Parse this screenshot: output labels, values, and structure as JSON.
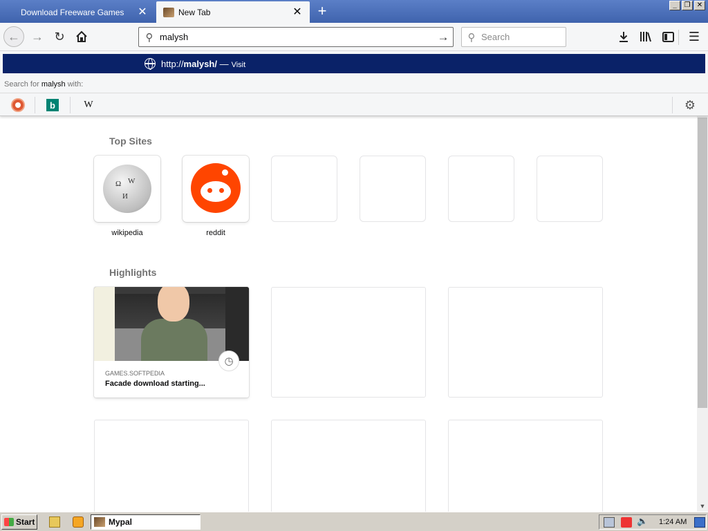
{
  "tabs": [
    {
      "title": "Download Freeware Games",
      "active": false
    },
    {
      "title": "New Tab",
      "active": true
    }
  ],
  "window_controls": {
    "minimize": "_",
    "restore": "❐",
    "close": "✕"
  },
  "navbar": {
    "url_value": "malysh ",
    "search_placeholder": "Search"
  },
  "popup": {
    "suggestion": {
      "prefix": "http://",
      "host": "malysh",
      "suffix": "/",
      "separator": "—",
      "action": "Visit"
    },
    "search_with": {
      "prefix": "Search for",
      "term": "malysh",
      "suffix": "with:"
    },
    "engines": [
      {
        "name": "DuckDuckGo",
        "icon": "duckduckgo-icon"
      },
      {
        "name": "Bing",
        "icon": "bing-icon",
        "glyph": "b"
      },
      {
        "name": "Wikipedia",
        "icon": "wikipedia-icon",
        "glyph": "W"
      }
    ]
  },
  "newtab": {
    "top_sites_title": "Top Sites",
    "top_sites": [
      {
        "label": "wikipedia",
        "icon": "wikipedia-globe-icon"
      },
      {
        "label": "reddit",
        "icon": "reddit-icon"
      },
      {
        "label": ""
      },
      {
        "label": ""
      },
      {
        "label": ""
      },
      {
        "label": ""
      }
    ],
    "highlights_title": "Highlights",
    "highlights": [
      {
        "source": "GAMES.SOFTPEDIA",
        "title": "Facade download starting...",
        "badge_icon": "clock-icon"
      }
    ]
  },
  "taskbar": {
    "start_label": "Start",
    "task_label": "Mypal",
    "clock": "1:24 AM"
  },
  "colors": {
    "tab_strip": "#3f63ad",
    "suggestion_highlight": "#0a2268",
    "reddit_orange": "#ff4500"
  }
}
